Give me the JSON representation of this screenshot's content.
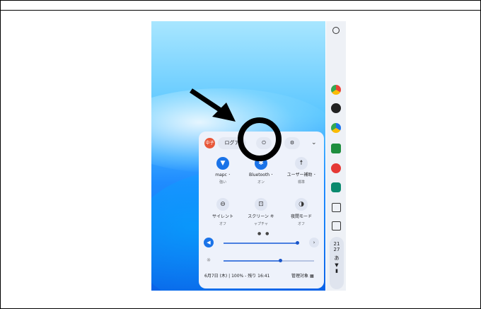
{
  "quick_settings": {
    "avatar_text": "中子",
    "logout_label": "ログア",
    "tiles": [
      {
        "label": "mapc ･",
        "sub": "強い"
      },
      {
        "label": "Bluetooth ･",
        "sub": "オン"
      },
      {
        "label": "ユーザー補助 ･",
        "sub": "標準"
      },
      {
        "label": "サイレント",
        "sub": "オフ"
      },
      {
        "label": "スクリーン キ",
        "sub": "ャプチャ"
      },
      {
        "label": "夜間モード",
        "sub": "オフ"
      }
    ],
    "page_dots": "● ●",
    "footer_date": "6月7日 (木)",
    "footer_battery": "100% - 残り 16:41",
    "footer_managed": "管理対象"
  },
  "shelf": {
    "clock_hour": "21",
    "clock_min": "27",
    "ime": "あ"
  },
  "colors": {
    "accent": "#1a73e8",
    "panel_bg": "#eef2fb"
  }
}
